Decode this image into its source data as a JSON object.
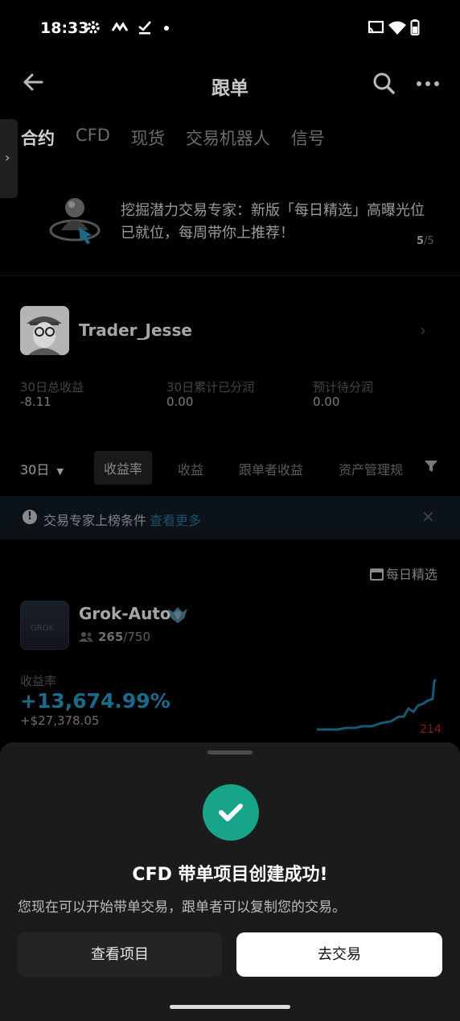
{
  "status_bar": {
    "time": "18:33",
    "icons": [
      "gear-icon",
      "nfc-icon",
      "check-icon",
      "dot-icon",
      "cast-icon",
      "wifi-icon",
      "battery-icon"
    ]
  },
  "header": {
    "title": "跟单"
  },
  "tabs": [
    "合约",
    "CFD",
    "现货",
    "交易机器人",
    "信号"
  ],
  "banner": {
    "text": "挖掘潜力交易专家：新版「每日精选」高曝光位已就位，每周带你上推荐！",
    "page_current": "5",
    "page_total": "/5"
  },
  "profile": {
    "name": "Trader_Jesse",
    "stats": [
      {
        "label": "30日总收益",
        "value": "-8.11"
      },
      {
        "label": "30日累计已分润",
        "value": "0.00"
      },
      {
        "label": "预计待分润",
        "value": "0.00"
      }
    ]
  },
  "filters": {
    "period": "30日",
    "items": [
      "收益率",
      "收益",
      "跟单者收益",
      "资产管理规"
    ]
  },
  "notice": {
    "text": "交易专家上榜条件",
    "link": "查看更多"
  },
  "daily_pick": "每日精选",
  "trader": {
    "logo_text": "GROK",
    "name": "Grok-Auto",
    "followers_current": "265",
    "followers_max": "/750",
    "roi_label": "收益率",
    "roi_value": "+13,674.99%",
    "pnl_value": "+$27,378.05",
    "side_number": "214"
  },
  "sheet": {
    "title": "CFD 带单项目创建成功!",
    "description": "您现在可以开始带单交易，跟单者可以复制您的交易。",
    "secondary_button": "查看项目",
    "primary_button": "去交易"
  },
  "colors": {
    "accent_green": "#17a48a",
    "roi_blue": "#1a6b8a",
    "link_blue": "#1e4f6b"
  }
}
